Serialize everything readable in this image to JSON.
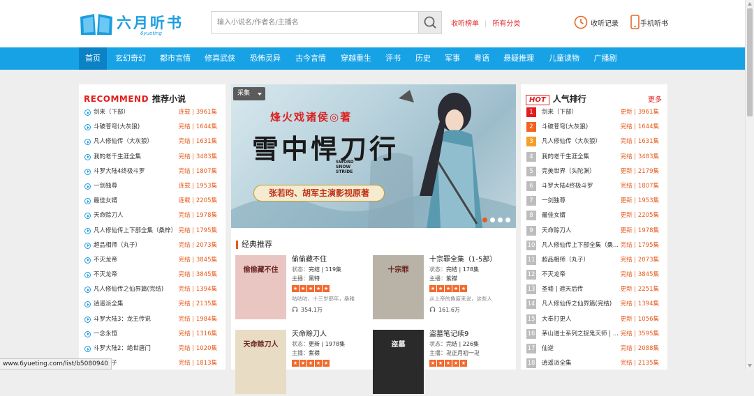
{
  "header": {
    "logo_text": "六月听书",
    "logo_sub": "6yueting",
    "search_placeholder": "输入小说名/作者名/主播名",
    "link_rank": "收听榜单",
    "link_categories": "所有分类",
    "history": "收听记录",
    "mobile": "手机听书"
  },
  "nav": [
    "首页",
    "玄幻奇幻",
    "都市言情",
    "修真武侠",
    "恐怖灵异",
    "古今言情",
    "穿越重生",
    "评书",
    "历史",
    "军事",
    "粤语",
    "悬疑推理",
    "儿童读物",
    "广播剧"
  ],
  "recommend": {
    "title_en": "RECOMMEND",
    "title_cn": "推荐小说",
    "items": [
      {
        "name": "剑来（下部）",
        "status": "连载 | 3961集"
      },
      {
        "name": "斗破苍穹(大灰狼)",
        "status": "完结 | 1644集"
      },
      {
        "name": "凡人修仙传（大灰狼）",
        "status": "完结 | 1631集"
      },
      {
        "name": "我的老千生涯全集",
        "status": "完结 | 3483集"
      },
      {
        "name": "斗罗大陆4终极斗罗",
        "status": "完结 | 1807集"
      },
      {
        "name": "一剑独尊",
        "status": "连载 | 1953集"
      },
      {
        "name": "最佳女婿",
        "status": "连载 | 2205集"
      },
      {
        "name": "天命赊刀人",
        "status": "完结 | 1978集"
      },
      {
        "name": "凡人修仙传上下部全集（桑梓）",
        "status": "完结 | 1795集"
      },
      {
        "name": "超品相师（丸子）",
        "status": "完结 | 2073集"
      },
      {
        "name": "不灭龙帝",
        "status": "完结 | 3845集"
      },
      {
        "name": "不灭龙帝",
        "status": "完结 | 3845集"
      },
      {
        "name": "凡人修仙传之仙界篇(完结)",
        "status": "完结 | 1394集"
      },
      {
        "name": "逍遥派全集",
        "status": "完结 | 2135集"
      },
      {
        "name": "斗罗大陆3：龙王传说",
        "status": "完结 | 1984集"
      },
      {
        "name": "一念永恒",
        "status": "完结 | 1316集"
      },
      {
        "name": "斗罗大陆2：绝世唐门",
        "status": "完结 | 1020集"
      },
      {
        "name": "明败家子",
        "status": "完结 | 1813集"
      }
    ]
  },
  "banner": {
    "category_label": "采集",
    "author_line": "烽火戏诸侯◎著",
    "title": "雪中悍刀行",
    "title_en": "SWORD SNOW STRIDE",
    "tagline": "张若昀、胡军主演影视原著"
  },
  "classics": {
    "title": "经典推荐",
    "books": [
      {
        "title": "偷偷藏不住",
        "status": "完结 | 119集",
        "host": "黑特",
        "desc": "咕咕咕，十三岁那年，桑稚",
        "plays": "354.1万",
        "cover_text": "偷偷藏不住",
        "cover_color": "#e9c6c2"
      },
      {
        "title": "十宗罪全集（1-5部）",
        "status": "完结 | 178集",
        "host": "紫襟",
        "desc": "从上帝的角度来说，这些人",
        "plays": "161.6万",
        "cover_text": "十宗罪",
        "cover_color": "#b9b2a6"
      },
      {
        "title": "天命赊刀人",
        "status": "更新 | 1978集",
        "host": "紫襟",
        "desc": "",
        "plays": "",
        "cover_text": "天命赊刀人",
        "cover_color": "#e8dcc4"
      },
      {
        "title": "盗墓笔记续9",
        "status": "完结 | 226集",
        "host": "卍正月初一卍",
        "desc": "",
        "plays": "",
        "cover_text": "盗墓",
        "cover_color": "#2a2a2a"
      }
    ],
    "label_status": "状态：",
    "label_host": "主播："
  },
  "ranking": {
    "hot": "HOT",
    "title": "人气排行",
    "more": "更多",
    "items": [
      {
        "name": "剑来（下部）",
        "status": "更新 | 3961集"
      },
      {
        "name": "斗破苍穹(大灰狼)",
        "status": "完结 | 1644集"
      },
      {
        "name": "凡人修仙传（大灰狼）",
        "status": "完结 | 1631集"
      },
      {
        "name": "我的老千生涯全集",
        "status": "完结 | 3483集"
      },
      {
        "name": "完美世界（头陀渊）",
        "status": "更新 | 2179集"
      },
      {
        "name": "斗罗大陆4终极斗罗",
        "status": "完结 | 1807集"
      },
      {
        "name": "一剑独尊",
        "status": "更新 | 1953集"
      },
      {
        "name": "最佳女婿",
        "status": "更新 | 2205集"
      },
      {
        "name": "天命赊刀人",
        "status": "更新 | 1978集"
      },
      {
        "name": "凡人修仙传上下部全集（桑...",
        "status": "完结 | 1795集"
      },
      {
        "name": "超品相师（丸子）",
        "status": "完结 | 2073集"
      },
      {
        "name": "不灭龙帝",
        "status": "完结 | 3845集"
      },
      {
        "name": "圣墟 | 遮天后传",
        "status": "更新 | 2251集"
      },
      {
        "name": "凡人修仙传之仙界篇(完结)",
        "status": "完结 | 1394集"
      },
      {
        "name": "大奉打更人",
        "status": "更新 | 1056集"
      },
      {
        "name": "茅山道士系列之捉鬼天师 | ...",
        "status": "完结 | 3595集"
      },
      {
        "name": "仙逆",
        "status": "完结 | 2088集"
      },
      {
        "name": "逍遥派全集",
        "status": "完结 | 2135集"
      }
    ]
  },
  "status_bar": "www.6yueting.com/list/b5080940",
  "colors": {
    "nav": "#17a2e6",
    "nav_active": "#0c82c6",
    "accent_red": "#e21d1d",
    "status_orange": "#e85a1c",
    "star": "#f26a2e"
  },
  "icons": [
    "book-logo-icon",
    "search-icon",
    "clock-icon",
    "phone-icon",
    "play-circle-icon",
    "headphone-icon",
    "star-icon"
  ]
}
